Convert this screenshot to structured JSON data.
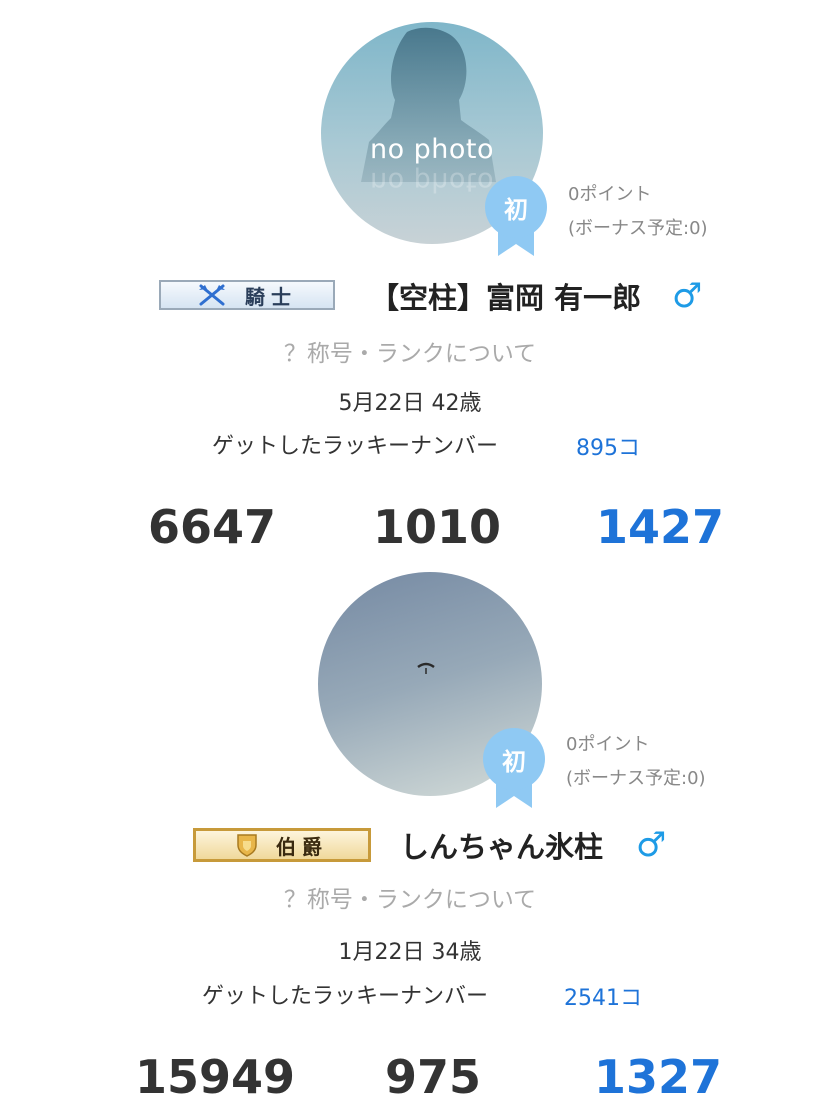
{
  "profiles": [
    {
      "photo_label": "no photo",
      "badge_label": "初",
      "points_text": "0ポイント",
      "bonus_text": "(ボーナス予定:0)",
      "rank_label": "騎士",
      "rank_icon": "crossed-axes-icon",
      "name": "【空柱】富岡 有一郎",
      "gender": "♂",
      "rank_help": "？称号・ランクについて",
      "birthday_age": "5月22日 42歳",
      "lucky_label": "ゲットしたラッキーナンバー",
      "lucky_count": "895コ",
      "stats": [
        "6647",
        "1010",
        "1427"
      ]
    },
    {
      "badge_label": "初",
      "points_text": "0ポイント",
      "bonus_text": "(ボーナス予定:0)",
      "rank_label": "伯爵",
      "rank_icon": "shield-icon",
      "name": "しんちゃん氷柱",
      "gender": "♂",
      "rank_help": "？称号・ランクについて",
      "birthday_age": "1月22日 34歳",
      "lucky_label": "ゲットしたラッキーナンバー",
      "lucky_count": "2541コ",
      "stats": [
        "15949",
        "975",
        "1327"
      ]
    }
  ],
  "colors": {
    "accent_blue": "#1e73d8",
    "gender_blue": "#1e9be6",
    "badge_blue": "#8fc9f3",
    "muted_text": "#aaaaaa"
  }
}
